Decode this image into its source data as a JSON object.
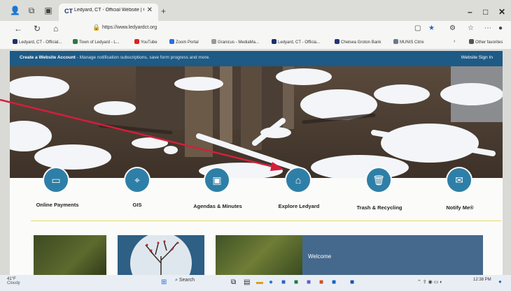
{
  "browser": {
    "tab_title": "Ledyard, CT - Official Website | O",
    "tab_favicon": "CT",
    "url": "https://www.ledyardct.org",
    "new_tab": "+",
    "minimize": "–",
    "maximize": "□",
    "close": "✕",
    "tab_close": "✕"
  },
  "bookmarks": [
    {
      "label": "Ledyard, CT - Official...",
      "color": "#1a2f6b"
    },
    {
      "label": "Town of Ledyard - L...",
      "color": "#2b7a3f"
    },
    {
      "label": "YouTube",
      "color": "#e02020"
    },
    {
      "label": "Zoom Portal",
      "color": "#2d6ce0"
    },
    {
      "label": "Granicus - MediaMa...",
      "color": "#999999"
    },
    {
      "label": "Ledyard, CT - Officia...",
      "color": "#1a2f6b"
    },
    {
      "label": "Chelsea Groton Bank",
      "color": "#24337a"
    },
    {
      "label": "MUNIS Citrix",
      "color": "#6a7a8a"
    },
    {
      "label": "Other favorites",
      "color": "#555555"
    }
  ],
  "site": {
    "banner_link": "Create a Website Account",
    "banner_text": " - Manage notification subscriptions, save form progress and more.",
    "signin": "Website Sign In",
    "quick_links": [
      {
        "label": "Online Payments",
        "icon": "payment-icon",
        "glyph": "▭"
      },
      {
        "label": "GIS",
        "icon": "map-icon",
        "glyph": "⌖"
      },
      {
        "label": "Agendas & Minutes",
        "icon": "calendar-icon",
        "glyph": "▣"
      },
      {
        "label": "Explore Ledyard",
        "icon": "building-icon",
        "glyph": "⌂"
      },
      {
        "label": "Trash & Recycling",
        "icon": "trash-icon",
        "glyph": "🗑"
      },
      {
        "label": "Notify Me®",
        "icon": "mail-icon",
        "glyph": "✉"
      }
    ],
    "welcome": "Welcome"
  },
  "taskbar": {
    "weather_temp": "41°F",
    "weather_cond": "Cloudy",
    "search": "Search",
    "time": "12:38 PM"
  },
  "colors": {
    "accent": "#2e7fa7",
    "banner": "#1d5a85",
    "annotation": "#d21f3c"
  }
}
